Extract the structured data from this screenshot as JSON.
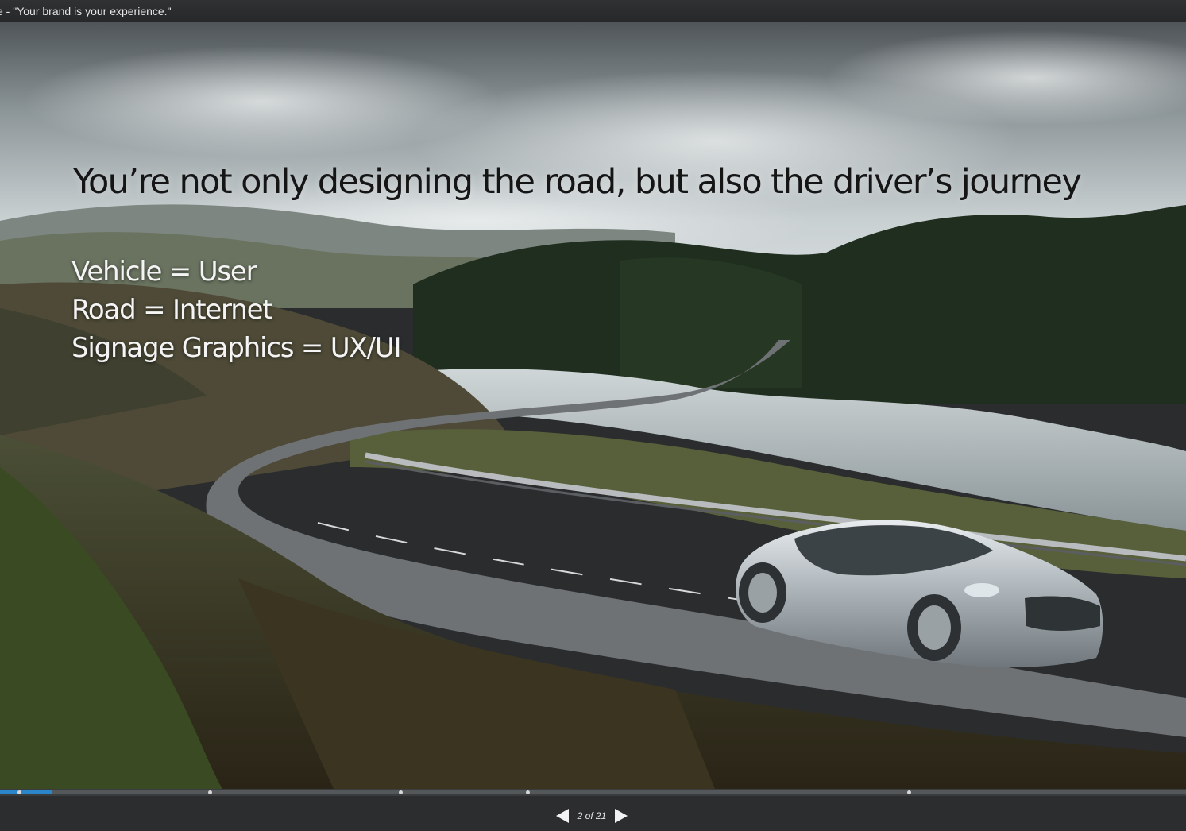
{
  "window": {
    "title": "e - \"Your brand is your experience.\""
  },
  "slide": {
    "heading": "You’re not only designing the road, but also the driver’s journey",
    "bullets": [
      "Vehicle = User",
      "Road = Internet",
      "Signage Graphics = UX/UI"
    ],
    "background_image": "car-on-winding-road-photo"
  },
  "player": {
    "progress_fraction": 0.0436,
    "chapter_markers": 6,
    "prev_icon": "prev-arrow-icon",
    "next_icon": "next-arrow-icon",
    "page_indicator": "2 of 21",
    "current_slide": 2,
    "total_slides": 21
  },
  "colors": {
    "progress_fill": "#2a86c8",
    "toolbar": "#2b2d2f"
  }
}
